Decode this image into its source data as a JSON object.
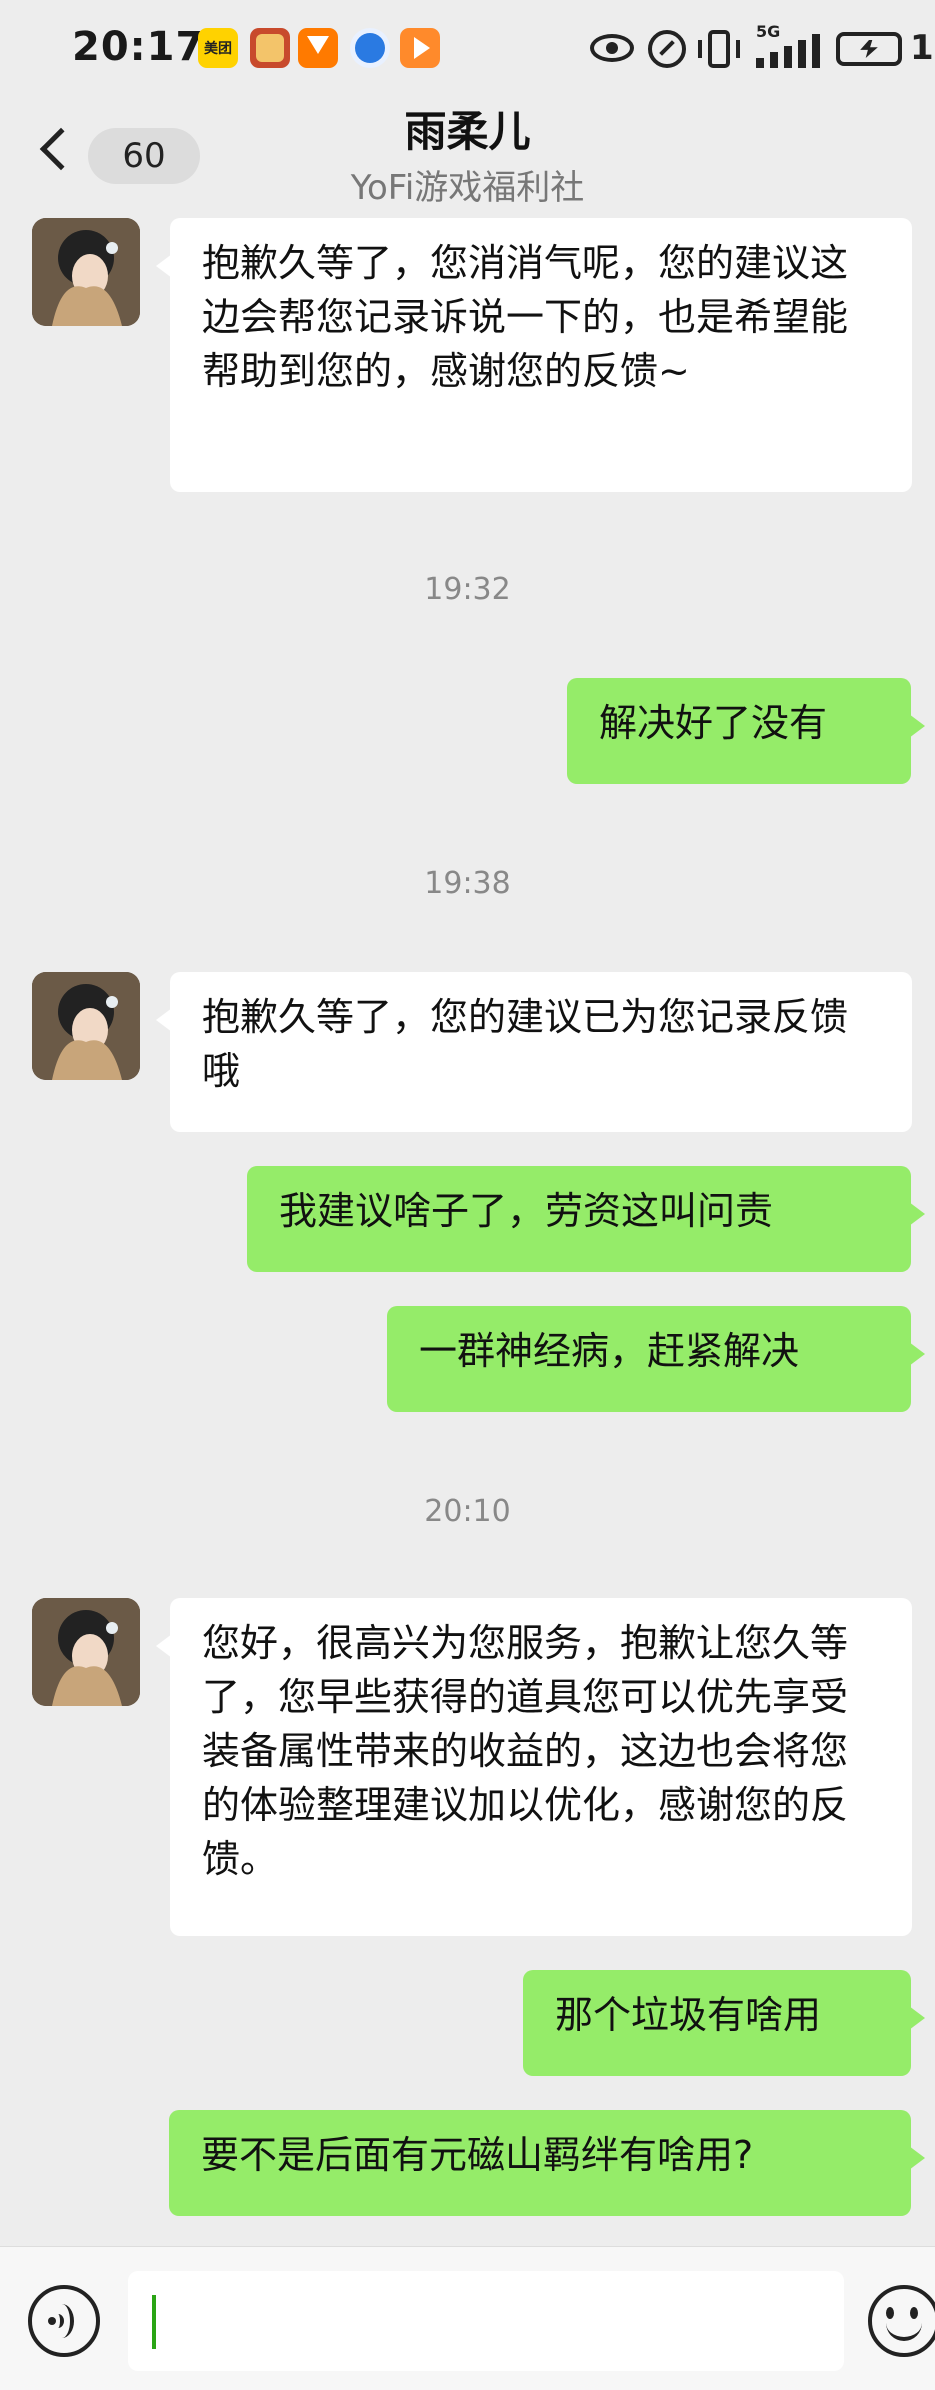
{
  "status_bar": {
    "time": "20:17",
    "notification_icons": [
      "meituan-icon",
      "game-icon",
      "taobao-icon",
      "browser-icon",
      "video-icon"
    ],
    "meituan_label": "美团",
    "network": "5G",
    "battery_level_text": "1"
  },
  "header": {
    "unread_count": "60",
    "title": "雨柔儿",
    "subtitle": "YoFi游戏福利社"
  },
  "messages": [
    {
      "type": "incoming",
      "text": "抱歉久等了，您消消气呢，您的建议这边会帮您记录诉说一下的，也是希望能帮助到您的，感谢您的反馈~"
    },
    {
      "type": "time",
      "text": "19:32"
    },
    {
      "type": "outgoing",
      "text": "解决好了没有"
    },
    {
      "type": "time",
      "text": "19:38"
    },
    {
      "type": "incoming",
      "text": "抱歉久等了，您的建议已为您记录反馈哦"
    },
    {
      "type": "outgoing",
      "text": "我建议啥子了，劳资这叫问责"
    },
    {
      "type": "outgoing",
      "text": "一群神经病，赶紧解决"
    },
    {
      "type": "time",
      "text": "20:10"
    },
    {
      "type": "incoming",
      "text": "您好，很高兴为您服务，抱歉让您久等了，您早些获得的道具您可以优先享受装备属性带来的收益的，这边也会将您的体验整理建议加以优化，感谢您的反馈。"
    },
    {
      "type": "outgoing",
      "text": "那个垃圾有啥用"
    },
    {
      "type": "outgoing",
      "text": "要不是后面有元磁山羁绊有啥用?"
    }
  ],
  "input_bar": {
    "placeholder": "",
    "value": ""
  },
  "colors": {
    "background": "#ededed",
    "outgoing_bubble": "#95ec69",
    "incoming_bubble": "#ffffff",
    "caret": "#2aa515"
  }
}
